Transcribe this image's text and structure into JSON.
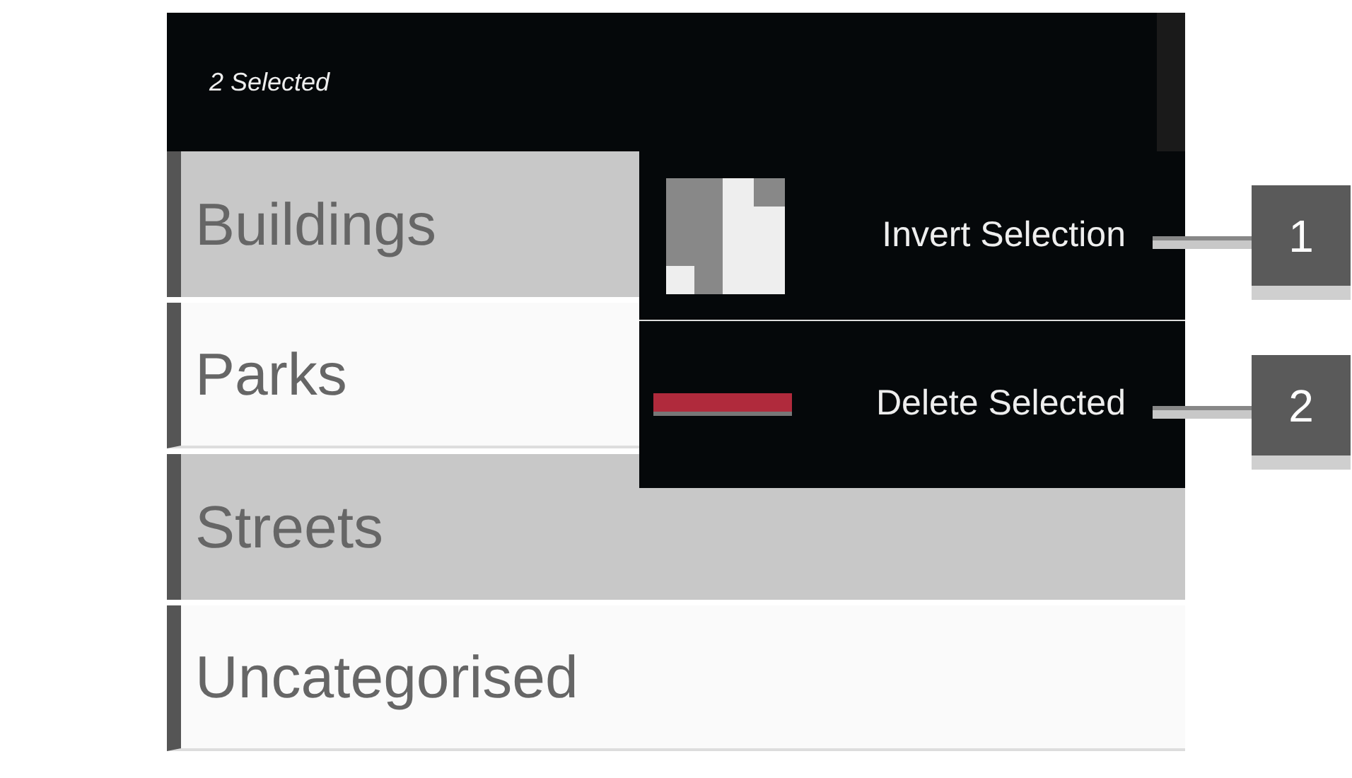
{
  "action_bar": {
    "title": "2 Selected"
  },
  "categories": [
    {
      "label": "Buildings",
      "selected": true
    },
    {
      "label": "Parks",
      "selected": false
    },
    {
      "label": "Streets",
      "selected": true
    },
    {
      "label": "Uncategorised",
      "selected": false
    }
  ],
  "menu": [
    {
      "label": "Invert Selection",
      "kind": "invert"
    },
    {
      "label": "Delete Selected",
      "kind": "delete"
    }
  ],
  "callouts": [
    "1",
    "2"
  ]
}
